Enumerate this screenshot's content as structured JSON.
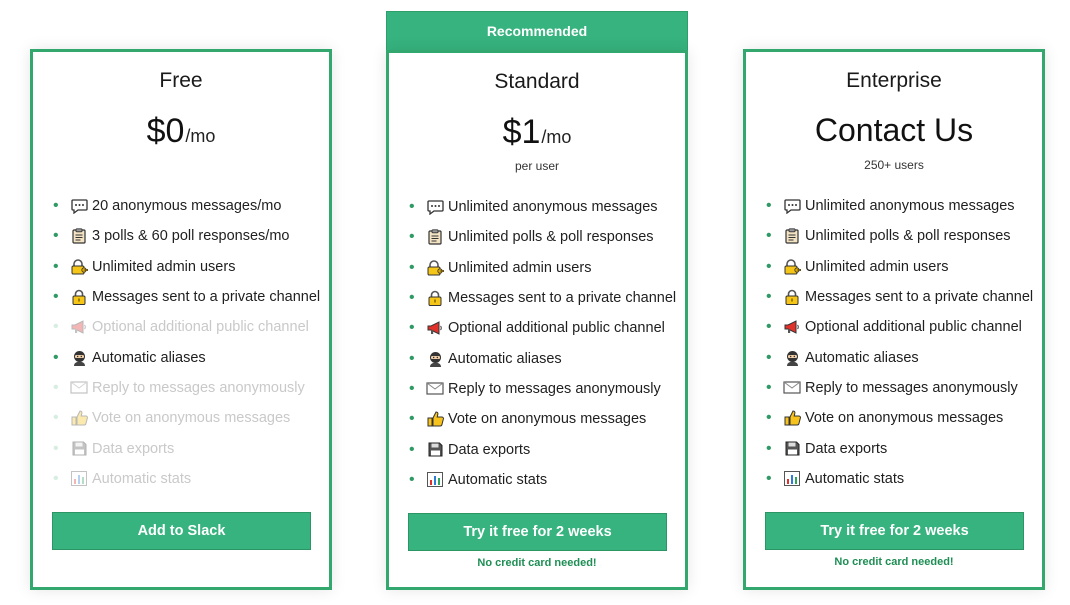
{
  "ribbon": "Recommended",
  "plans": [
    {
      "name": "Free",
      "price_amount": "$0",
      "price_unit": "/mo",
      "price_note": "",
      "cta": "Add to Slack",
      "cta_note": "",
      "features": [
        {
          "icon": "speech-bubble-icon",
          "text": "20 anonymous messages/mo",
          "enabled": true
        },
        {
          "icon": "clipboard-icon",
          "text": "3 polls & 60 poll responses/mo",
          "enabled": true
        },
        {
          "icon": "lock-with-key-icon",
          "text": "Unlimited admin users",
          "enabled": true
        },
        {
          "icon": "lock-icon",
          "text": "Messages sent to a private channel",
          "enabled": true
        },
        {
          "icon": "megaphone-icon",
          "text": "Optional additional public channel",
          "enabled": false
        },
        {
          "icon": "ninja-icon",
          "text": "Automatic aliases",
          "enabled": true
        },
        {
          "icon": "envelope-icon",
          "text": "Reply to messages anonymously",
          "enabled": false
        },
        {
          "icon": "thumbs-up-icon",
          "text": "Vote on anonymous messages",
          "enabled": false
        },
        {
          "icon": "floppy-disk-icon",
          "text": "Data exports",
          "enabled": false
        },
        {
          "icon": "bar-chart-icon",
          "text": "Automatic stats",
          "enabled": false
        }
      ]
    },
    {
      "name": "Standard",
      "price_amount": "$1",
      "price_unit": "/mo",
      "price_note": "per user",
      "cta": "Try it free for 2 weeks",
      "cta_note": "No credit card needed!",
      "features": [
        {
          "icon": "speech-bubble-icon",
          "text": "Unlimited anonymous messages",
          "enabled": true
        },
        {
          "icon": "clipboard-icon",
          "text": "Unlimited polls & poll responses",
          "enabled": true
        },
        {
          "icon": "lock-with-key-icon",
          "text": "Unlimited admin users",
          "enabled": true
        },
        {
          "icon": "lock-icon",
          "text": "Messages sent to a private channel",
          "enabled": true
        },
        {
          "icon": "megaphone-icon",
          "text": "Optional additional public channel",
          "enabled": true
        },
        {
          "icon": "ninja-icon",
          "text": "Automatic aliases",
          "enabled": true
        },
        {
          "icon": "envelope-icon",
          "text": "Reply to messages anonymously",
          "enabled": true
        },
        {
          "icon": "thumbs-up-icon",
          "text": "Vote on anonymous messages",
          "enabled": true
        },
        {
          "icon": "floppy-disk-icon",
          "text": "Data exports",
          "enabled": true
        },
        {
          "icon": "bar-chart-icon",
          "text": "Automatic stats",
          "enabled": true
        }
      ]
    },
    {
      "name": "Enterprise",
      "price_amount": "Contact Us",
      "price_unit": "",
      "price_note": "250+ users",
      "cta": "Try it free for 2 weeks",
      "cta_note": "No credit card needed!",
      "features": [
        {
          "icon": "speech-bubble-icon",
          "text": "Unlimited anonymous messages",
          "enabled": true
        },
        {
          "icon": "clipboard-icon",
          "text": "Unlimited polls & poll responses",
          "enabled": true
        },
        {
          "icon": "lock-with-key-icon",
          "text": "Unlimited admin users",
          "enabled": true
        },
        {
          "icon": "lock-icon",
          "text": "Messages sent to a private channel",
          "enabled": true
        },
        {
          "icon": "megaphone-icon",
          "text": "Optional additional public channel",
          "enabled": true
        },
        {
          "icon": "ninja-icon",
          "text": "Automatic aliases",
          "enabled": true
        },
        {
          "icon": "envelope-icon",
          "text": "Reply to messages anonymously",
          "enabled": true
        },
        {
          "icon": "thumbs-up-icon",
          "text": "Vote on anonymous messages",
          "enabled": true
        },
        {
          "icon": "floppy-disk-icon",
          "text": "Data exports",
          "enabled": true
        },
        {
          "icon": "bar-chart-icon",
          "text": "Automatic stats",
          "enabled": true
        }
      ]
    }
  ],
  "colors": {
    "accent": "#36b37e",
    "border": "#33a86e",
    "note_text": "#1e8e54",
    "disabled_text": "#c9c9c9"
  }
}
